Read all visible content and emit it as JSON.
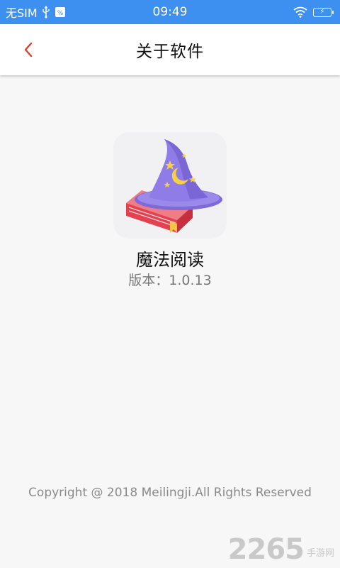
{
  "status_bar": {
    "carrier": "无SIM",
    "time": "09:49",
    "icons": [
      "usb-icon",
      "app-notification-icon",
      "wifi-icon",
      "battery-charging-icon"
    ]
  },
  "nav": {
    "back_icon": "chevron-left-icon",
    "title": "关于软件"
  },
  "app": {
    "icon": "wizard-hat-book-icon",
    "name": "魔法阅读",
    "version": "版本：1.0.13"
  },
  "footer": {
    "copyright": "Copyright @ 2018 Meilingji.All Rights Reserved"
  },
  "watermark": {
    "number": "2265",
    "text": "手游网"
  },
  "colors": {
    "status_bar": "#3d8ff0",
    "accent": "#e0412c",
    "background": "#f7f7f7"
  }
}
